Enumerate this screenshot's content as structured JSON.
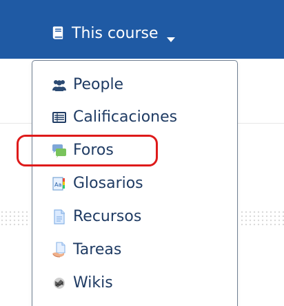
{
  "header": {
    "course_menu_label": "This course",
    "icon": "book-icon",
    "caret": "caret-down-icon"
  },
  "dropdown": {
    "items": [
      {
        "label": "People",
        "icon": "people-icon"
      },
      {
        "label": "Calificaciones",
        "icon": "grades-icon"
      },
      {
        "label": "Foros",
        "icon": "forums-icon"
      },
      {
        "label": "Glosarios",
        "icon": "glossary-icon"
      },
      {
        "label": "Recursos",
        "icon": "resources-icon"
      },
      {
        "label": "Tareas",
        "icon": "assignments-icon"
      },
      {
        "label": "Wikis",
        "icon": "wikis-icon"
      }
    ]
  },
  "colors": {
    "topbar": "#1f5aa4",
    "menu_text": "#1f3b63",
    "highlight": "#de1a1a"
  }
}
